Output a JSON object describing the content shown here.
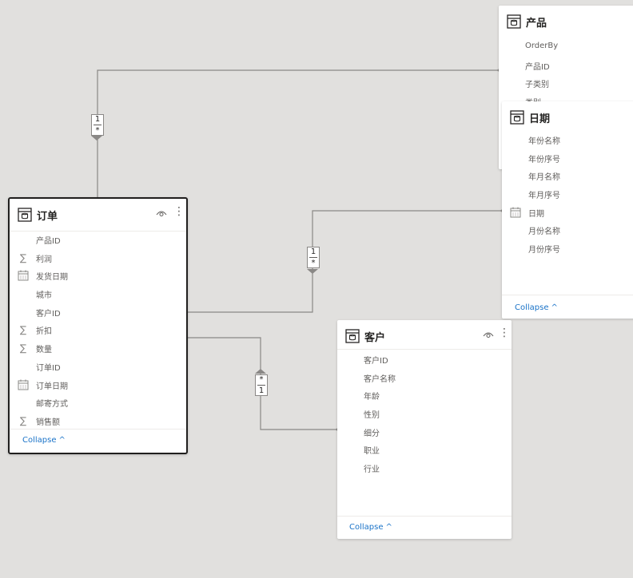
{
  "tables": {
    "orders": {
      "title": "订单",
      "fields": [
        {
          "name": "产品ID",
          "icon": "none"
        },
        {
          "name": "利润",
          "icon": "sigma"
        },
        {
          "name": "发货日期",
          "icon": "calendar"
        },
        {
          "name": "城市",
          "icon": "none"
        },
        {
          "name": "客户ID",
          "icon": "none"
        },
        {
          "name": "折扣",
          "icon": "sigma"
        },
        {
          "name": "数量",
          "icon": "sigma"
        },
        {
          "name": "订单ID",
          "icon": "none"
        },
        {
          "name": "订单日期",
          "icon": "calendar"
        },
        {
          "name": "邮寄方式",
          "icon": "none"
        },
        {
          "name": "销售额",
          "icon": "sigma"
        }
      ],
      "collapse_label": "Collapse"
    },
    "product": {
      "title": "产品",
      "fields": [
        {
          "name": "OrderBy",
          "icon": "none"
        },
        {
          "name": "产品ID",
          "icon": "none"
        },
        {
          "name": "子类别",
          "icon": "none"
        },
        {
          "name": "类别",
          "icon": "none"
        }
      ]
    },
    "date": {
      "title": "日期",
      "fields": [
        {
          "name": "年份名称",
          "icon": "none"
        },
        {
          "name": "年份序号",
          "icon": "none"
        },
        {
          "name": "年月名称",
          "icon": "none"
        },
        {
          "name": "年月序号",
          "icon": "none"
        },
        {
          "name": "日期",
          "icon": "calendar"
        },
        {
          "name": "月份名称",
          "icon": "none"
        },
        {
          "name": "月份序号",
          "icon": "none"
        }
      ],
      "collapse_label": "Collapse"
    },
    "customer": {
      "title": "客户",
      "fields": [
        {
          "name": "客户ID",
          "icon": "none"
        },
        {
          "name": "客户名称",
          "icon": "none"
        },
        {
          "name": "年龄",
          "icon": "none"
        },
        {
          "name": "性别",
          "icon": "none"
        },
        {
          "name": "细分",
          "icon": "none"
        },
        {
          "name": "职业",
          "icon": "none"
        },
        {
          "name": "行业",
          "icon": "none"
        }
      ],
      "collapse_label": "Collapse"
    }
  },
  "relationships": {
    "orders_product": {
      "top": "1",
      "bottom": "*"
    },
    "orders_date": {
      "top": "1",
      "bottom": "*"
    },
    "orders_customer": {
      "top": "*",
      "bottom": "1"
    }
  },
  "colors": {
    "canvas": "#e1e0de",
    "card": "#ffffff",
    "link": "#1a73c8",
    "line": "#8a8886"
  }
}
